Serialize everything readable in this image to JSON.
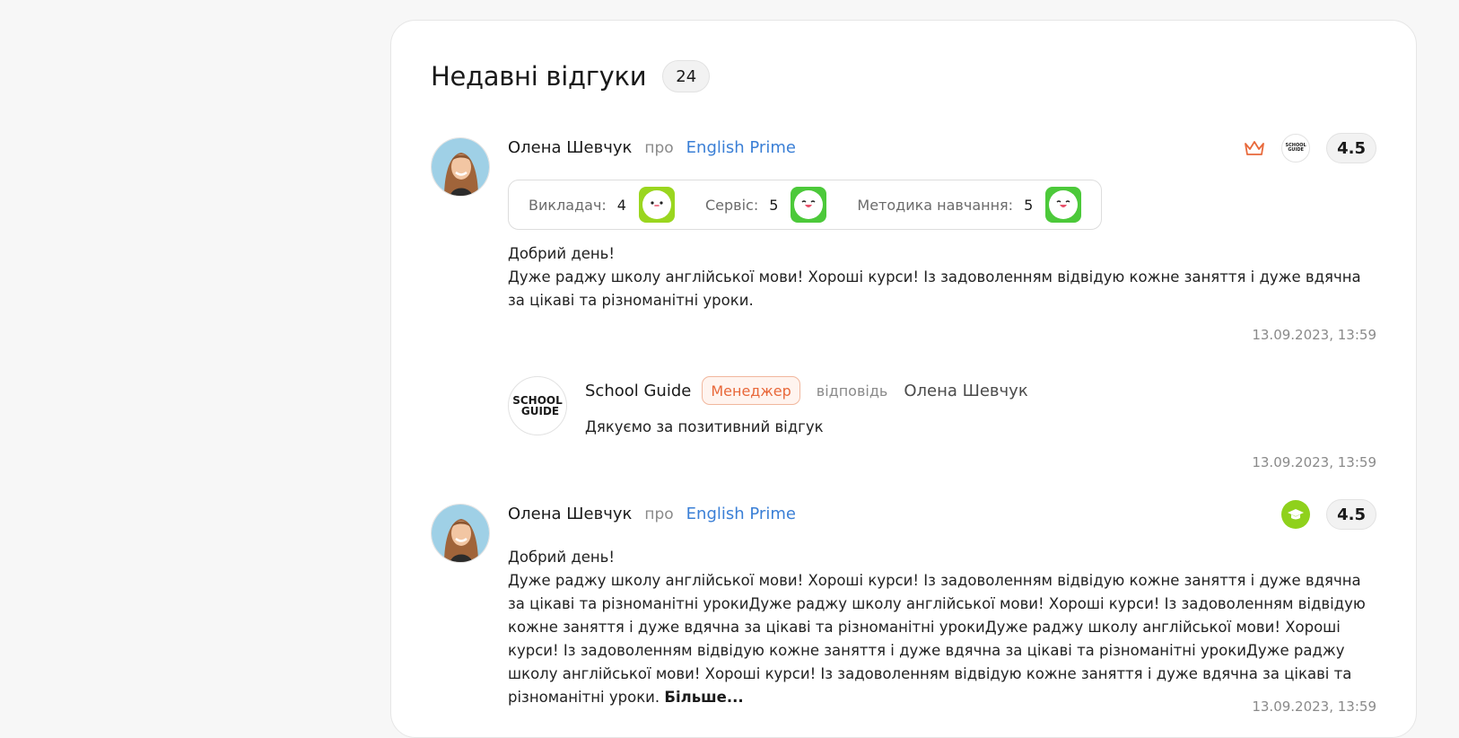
{
  "header": {
    "title": "Недавні відгуки",
    "count": "24"
  },
  "reviews": [
    {
      "author": "Олена Шевчук",
      "about_word": "про",
      "school": "English Prime",
      "rating": "4.5",
      "criteria": [
        {
          "label": "Викладач:",
          "value": "4",
          "color": "#9ad61f"
        },
        {
          "label": "Сервіс:",
          "value": "5",
          "color": "#4cc93a"
        },
        {
          "label": "Методика навчання:",
          "value": "5",
          "color": "#4cc93a"
        }
      ],
      "greeting": "Добрий день!",
      "text": "Дуже раджу школу англійської мови! Хороші курси! Із задоволенням відвідую кожне заняття і дуже вдячна за цікаві та різноманітні уроки.",
      "date": "13.09.2023, 13:59",
      "icons": [
        "crown-icon",
        "school-guide-logo"
      ],
      "small_logo_text": "SCHOOL GUIDE"
    },
    {
      "author": "Олена Шевчук",
      "about_word": "про",
      "school": "English Prime",
      "rating": "4.5",
      "greeting": "Добрий день!",
      "text": "Дуже раджу школу англійської мови! Хороші курси! Із задоволенням відвідую кожне заняття і дуже вдячна за цікаві та різноманітні урокиДуже раджу школу англійської мови! Хороші курси! Із задоволенням відвідую кожне заняття і дуже вдячна за цікаві та різноманітні урокиДуже раджу школу англійської мови! Хороші курси! Із задоволенням відвідую кожне заняття і дуже вдячна за цікаві та різноманітні урокиДуже раджу школу англійської мови! Хороші курси! Із задоволенням відвідую кожне заняття і дуже вдячна за цікаві та різноманітні уроки.",
      "more_label": "Більше...",
      "date": "13.09.2023, 13:59",
      "icons": [
        "graduation-cap-icon"
      ]
    }
  ],
  "reply": {
    "logo_line1": "SCHOOL",
    "logo_line2": "GUIDE",
    "author": "School Guide",
    "badge": "Менеджер",
    "replied_word": "відповідь",
    "to": "Олена Шевчук",
    "text": "Дякуємо за позитивний відгук",
    "date": "13.09.2023, 13:59"
  },
  "colors": {
    "link": "#3a7fd6",
    "accent_orange": "#e8683a",
    "green_good": "#4cc93a",
    "green_ok": "#9ad61f",
    "grad_badge": "#8fd11c"
  }
}
